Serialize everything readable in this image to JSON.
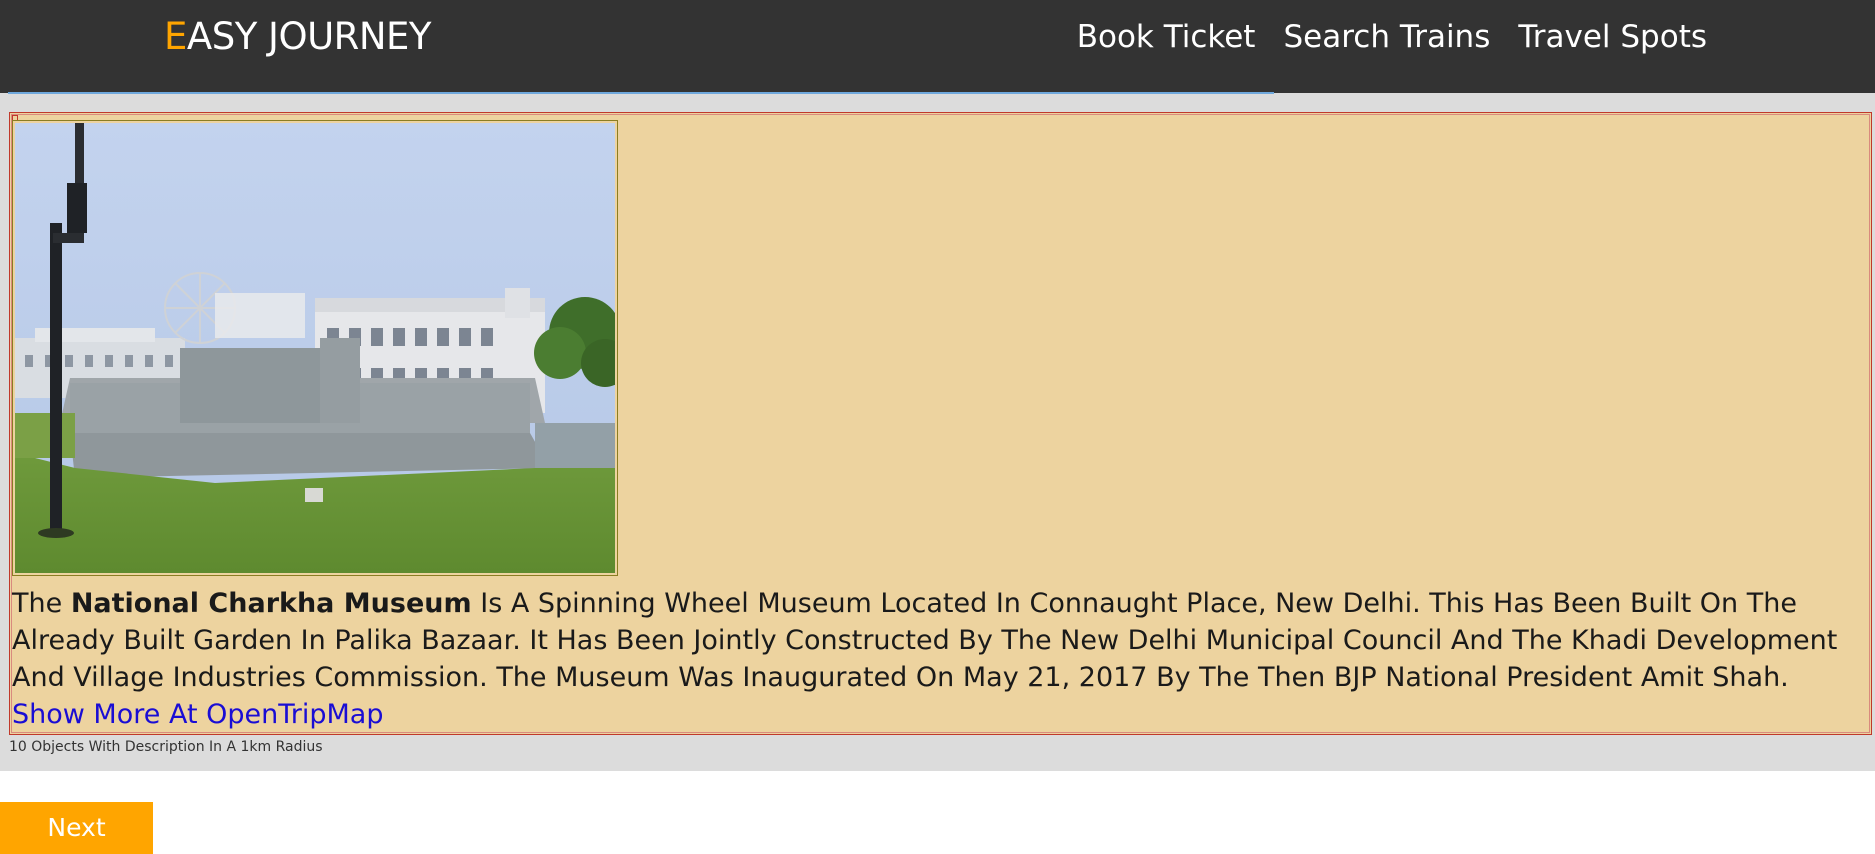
{
  "brand": {
    "first_letter": "E",
    "rest": "ASY JOURNEY",
    "accent_color": "#ffa500"
  },
  "nav": {
    "items": [
      {
        "label": "Book Ticket"
      },
      {
        "label": "Search Trains"
      },
      {
        "label": "Travel Spots"
      }
    ]
  },
  "place": {
    "intro": "The",
    "name": "National Charkha Museum",
    "description": "Is A Spinning Wheel Museum Located In Connaught Place, New Delhi. This Has Been Built On The Already Built Garden In Palika Bazaar. It Has Been Jointly Constructed By The New Delhi Municipal Council And The Khadi Development And Village Industries Commission. The Museum Was Inaugurated On May 21, 2017 By The Then BJP National President Amit Shah.",
    "link_label": "Show More At OpenTripMap",
    "photo_icon": "museum-photo"
  },
  "results": {
    "summary": "10 Objects With Description In A 1km Radius"
  },
  "pager": {
    "next_label": "Next"
  },
  "colors": {
    "navbar": "#333333",
    "card_background": "#edd39f",
    "card_border": "#c0392b",
    "button": "#ffa500",
    "link": "#1a0dd4"
  }
}
